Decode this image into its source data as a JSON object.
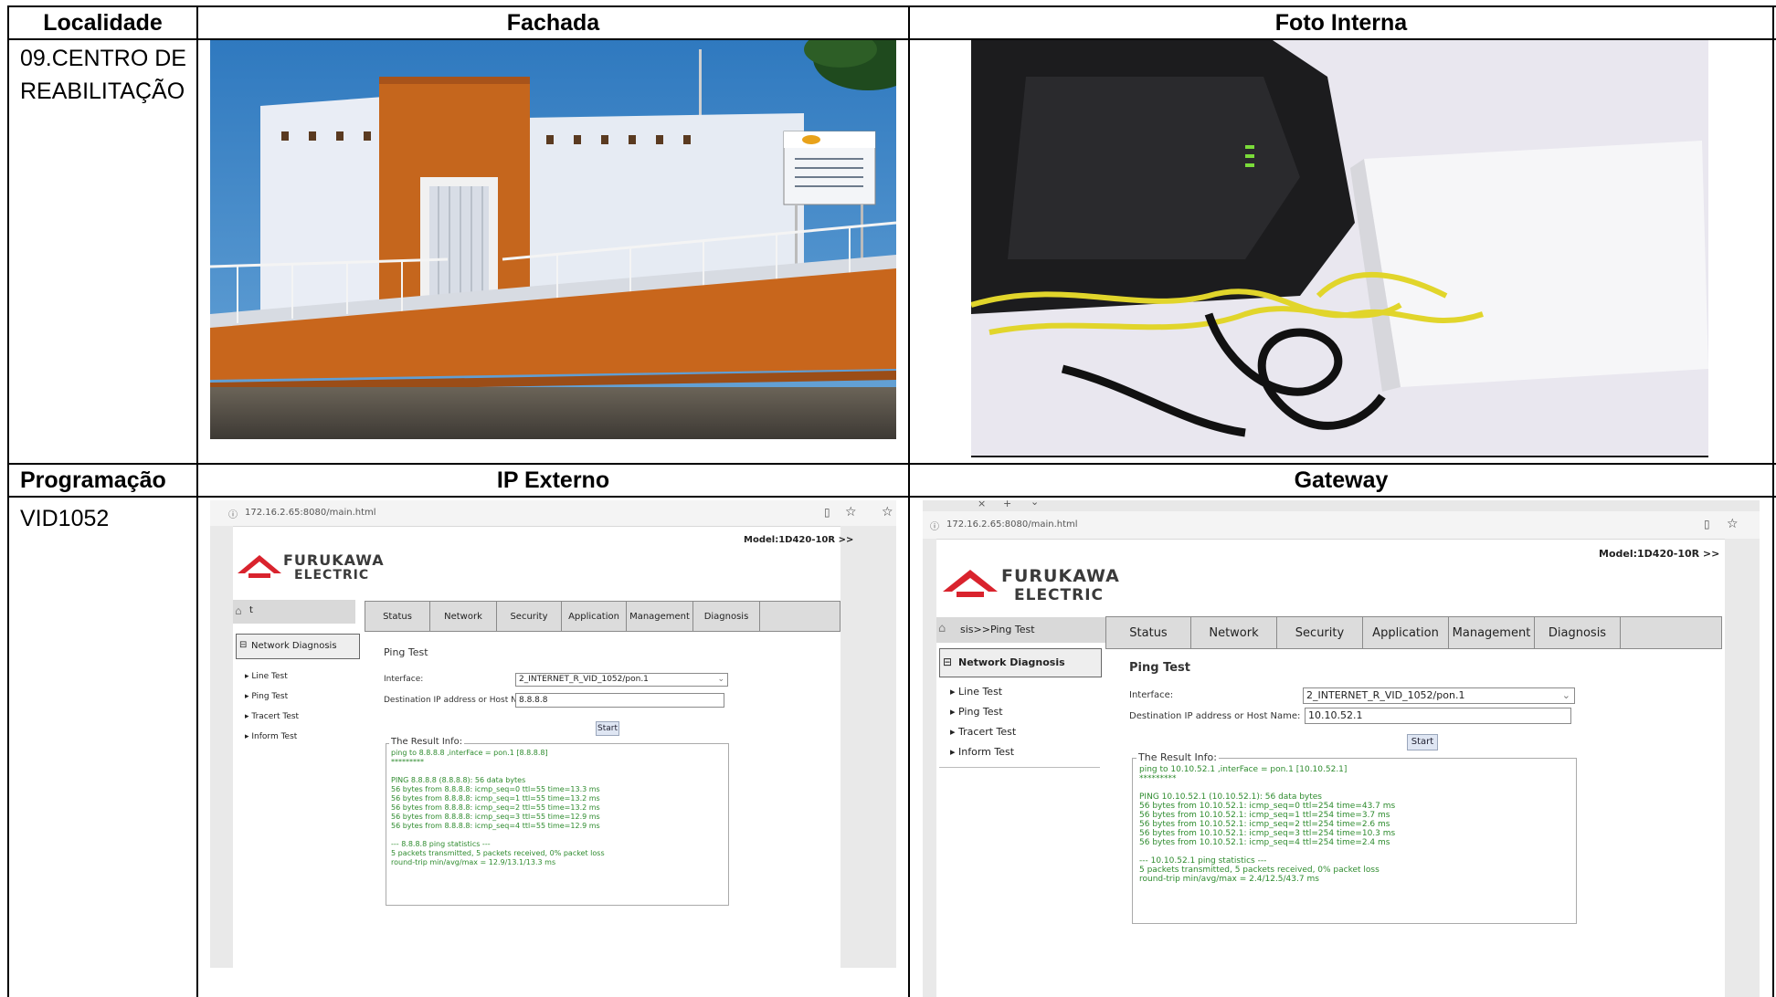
{
  "table": {
    "headers": {
      "localidade": "Localidade",
      "fachada": "Fachada",
      "foto_interna": "Foto Interna",
      "programacao": "Programação",
      "ip_externo": "IP Externo",
      "gateway": "Gateway"
    },
    "localidade_value_line1": "09.CENTRO DE",
    "localidade_value_line2": "REABILITAÇÃO",
    "programacao_value": "VID1052"
  },
  "ip_externo_shot": {
    "url": "172.16.2.65:8080/main.html",
    "logo_line1": "FURUKAWA",
    "logo_line2": "ELECTRIC",
    "model": "Model:1D420-10R  >>",
    "breadcrumb": "t",
    "tabs": [
      "Status",
      "Network",
      "Security",
      "Application",
      "Management",
      "Diagnosis"
    ],
    "side_group": "Network Diagnosis",
    "side_items": [
      "Line Test",
      "Ping Test",
      "Tracert Test",
      "Inform Test"
    ],
    "page_title": "Ping Test",
    "interface_label": "Interface:",
    "interface_value": "2_INTERNET_R_VID_1052/pon.1",
    "dest_label": "Destination IP address or Host Name:",
    "dest_value": "8.8.8.8",
    "start_label": "Start",
    "result_legend": "The Result Info:",
    "result_lines": [
      "ping to 8.8.8.8 ,interFace = pon.1 [8.8.8.8]",
      "*********",
      "",
      "PING 8.8.8.8 (8.8.8.8): 56 data bytes",
      "56 bytes from 8.8.8.8: icmp_seq=0 ttl=55 time=13.3 ms",
      "56 bytes from 8.8.8.8: icmp_seq=1 ttl=55 time=13.2 ms",
      "56 bytes from 8.8.8.8: icmp_seq=2 ttl=55 time=13.2 ms",
      "56 bytes from 8.8.8.8: icmp_seq=3 ttl=55 time=12.9 ms",
      "56 bytes from 8.8.8.8: icmp_seq=4 ttl=55 time=12.9 ms",
      "",
      "--- 8.8.8.8 ping statistics ---",
      "5 packets transmitted, 5 packets received, 0% packet loss",
      "round-trip min/avg/max = 12.9/13.1/13.3 ms"
    ]
  },
  "gateway_shot": {
    "url": "172.16.2.65:8080/main.html",
    "logo_line1": "FURUKAWA",
    "logo_line2": "ELECTRIC",
    "model": "Model:1D420-10R  >>",
    "breadcrumb": "sis>>Ping Test",
    "tabs": [
      "Status",
      "Network",
      "Security",
      "Application",
      "Management",
      "Diagnosis"
    ],
    "side_group": "Network Diagnosis",
    "side_items": [
      "Line Test",
      "Ping Test",
      "Tracert Test",
      "Inform Test"
    ],
    "page_title": "Ping Test",
    "interface_label": "Interface:",
    "interface_value": "2_INTERNET_R_VID_1052/pon.1",
    "dest_label": "Destination IP address or Host Name:",
    "dest_value": "10.10.52.1",
    "start_label": "Start",
    "result_legend": "The Result Info:",
    "result_lines": [
      "ping to 10.10.52.1 ,interFace = pon.1 [10.10.52.1]",
      "*********",
      "",
      "PING 10.10.52.1 (10.10.52.1): 56 data bytes",
      "56 bytes from 10.10.52.1: icmp_seq=0 ttl=254 time=43.7 ms",
      "56 bytes from 10.10.52.1: icmp_seq=1 ttl=254 time=3.7 ms",
      "56 bytes from 10.10.52.1: icmp_seq=2 ttl=254 time=2.6 ms",
      "56 bytes from 10.10.52.1: icmp_seq=3 ttl=254 time=10.3 ms",
      "56 bytes from 10.10.52.1: icmp_seq=4 ttl=254 time=2.4 ms",
      "",
      "--- 10.10.52.1 ping statistics ---",
      "5 packets transmitted, 5 packets received, 0% packet loss",
      "round-trip min/avg/max = 2.4/12.5/43.7 ms"
    ]
  },
  "colors": {
    "logo_red": "#d9232d",
    "result_green": "#2e8b2e",
    "wall_orange": "#c96a1f",
    "sky_blue": "#3f86c6"
  }
}
